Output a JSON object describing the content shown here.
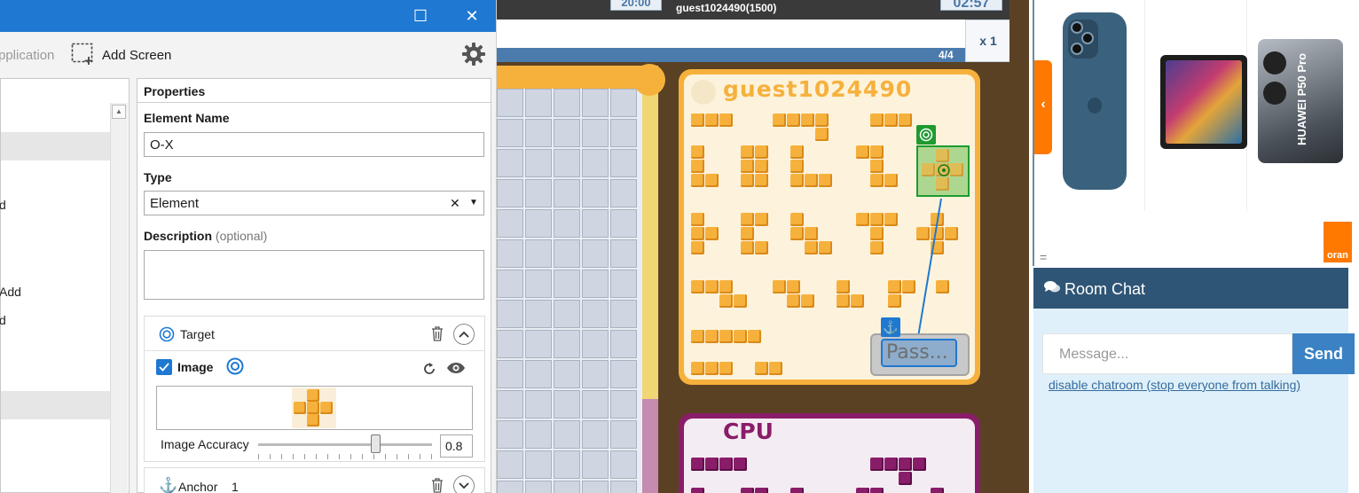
{
  "window": {
    "maximize_glyph": "☐",
    "close_glyph": "✕"
  },
  "toolbar": {
    "application_label": "pplication",
    "add_screen_label": "Add Screen",
    "settings_icon": "gear-icon"
  },
  "tree": {
    "items": [
      "d",
      "Add",
      "d"
    ]
  },
  "properties": {
    "header": "Properties",
    "element_name_label": "Element Name",
    "element_name_value": "O-X",
    "type_label": "Type",
    "type_value": "Element",
    "type_clear": "✕",
    "type_arrow": "▼",
    "description_label": "Description",
    "description_optional": "(optional)",
    "description_value": "",
    "target": {
      "label": "Target",
      "image_label": "Image",
      "image_checked": true,
      "accuracy_label": "Image Accuracy",
      "accuracy_value": "0.8",
      "accuracy_fraction": 0.8
    },
    "anchor": {
      "label": "Anchor",
      "count": "1"
    }
  },
  "game": {
    "timer_left": "20:00",
    "player_header": "guest1024490(1500)",
    "timer_right": "02:57",
    "progress": "4/4",
    "multiplier": "x 1",
    "player_board_name": "guest1024490",
    "cpu_board_name": "CPU",
    "pass_button": "Pass..."
  },
  "ad": {
    "products": [
      "iPhone",
      "iPad",
      "HUAWEI P50 Pro"
    ],
    "brand_tab": "oran",
    "menu_glyph": "="
  },
  "chat": {
    "title": "Room Chat",
    "placeholder": "Message...",
    "send_label": "Send",
    "disable_link": "disable chatroom (stop everyone from talking)"
  },
  "colors": {
    "titlebar": "#1f78d1",
    "accent_blue": "#1f78d1",
    "board_orange": "#f6b13c",
    "cpu_purple": "#8a1d6a",
    "chat_header": "#2f5576",
    "send_button": "#3a82c4",
    "ad_orange": "#ff7900"
  }
}
